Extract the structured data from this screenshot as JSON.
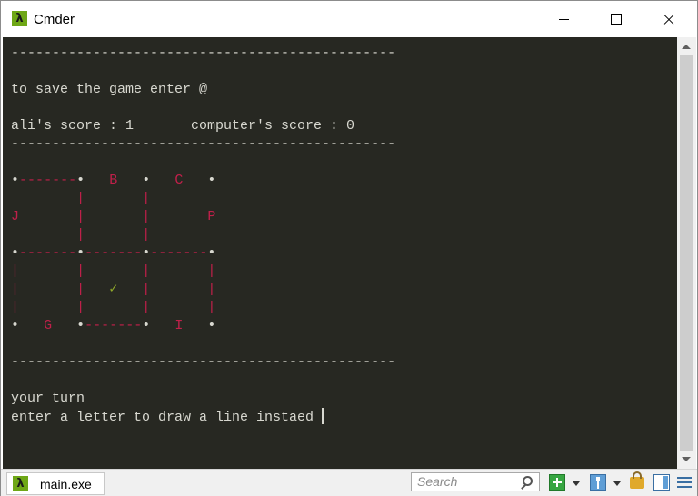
{
  "window": {
    "title": "Cmder",
    "app_icon": "λ"
  },
  "console": {
    "lines": [
      "-----------------------------------------------",
      "",
      "to save the game enter @",
      "",
      "ali's score : 1       computer's score : 0",
      "-----------------------------------------------",
      "",
      "•-------•   B   •   C   •",
      "        |       |",
      "J       |       |       P",
      "        |       |",
      "•-------•-------•-------•",
      "|       |       |       |",
      "|       |   ✓   |       |",
      "|       |       |       |",
      "•   G   •-------•   I   •",
      "",
      "-----------------------------------------------",
      "",
      "your turn",
      "enter a letter to draw a line instaed "
    ]
  },
  "statusbar": {
    "tab_label": "main.exe",
    "tab_icon": "λ",
    "search_placeholder": "Search"
  },
  "colors": {
    "console_bg": "#272822",
    "text": "#d8d8d0",
    "letters": "#c0204a",
    "check": "#8fa82a",
    "accent": "#6ea716"
  }
}
